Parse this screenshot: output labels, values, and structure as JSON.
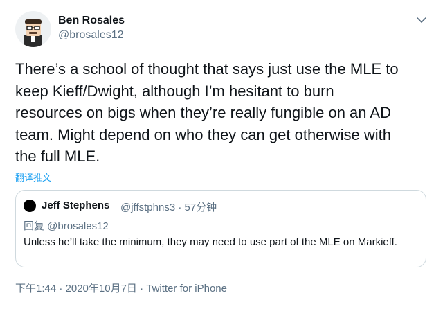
{
  "tweet": {
    "author": {
      "name": "Ben Rosales",
      "handle": "@brosales12",
      "avatar_icon": "cartoon-avatar-icon"
    },
    "more_icon": "chevron-down-icon",
    "text": "There’s a school of thought that says just use the MLE to\nkeep Kieff/Dwight, although I’m hesitant to burn\nresources on bigs when they’re really fungible on an AD\nteam. Might depend on who they can get otherwise with\nthe full MLE.",
    "translate_label": "翻译推文",
    "quote": {
      "author_name": "Jeff Stephens",
      "meta": "@jffstphns3 · 57分钟",
      "reply_to": "回复 @brosales12",
      "text": "Unless he’ll take the minimum,  they may need to use part of the MLE on Markieff."
    },
    "timestamp": "下午1:44 · 2020年10月7日 · Twitter for iPhone"
  },
  "colors": {
    "primary_text": "#0f1419",
    "secondary_text": "#5b7083",
    "link": "#1da1f2",
    "border": "#cfd9de"
  }
}
